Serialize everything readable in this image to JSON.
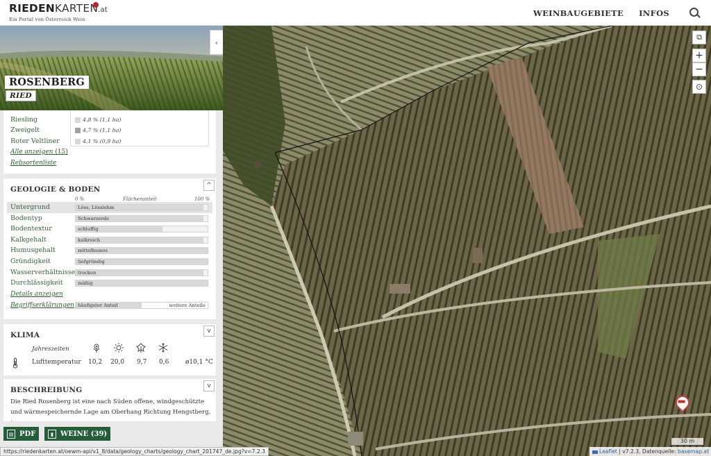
{
  "header": {
    "logo_bold": "RIEDEN",
    "logo_light": "KARTEN",
    "logo_tld": ".at",
    "logo_tagline": "Ein Portal von Österreich Wein",
    "nav": [
      "WEINBAUGEBIETE",
      "INFOS"
    ]
  },
  "ried": {
    "name": "ROSENBERG",
    "type": "RIED"
  },
  "sorten": {
    "items": [
      {
        "name": "Riesling",
        "value": "4,8 % (1,1 ha)",
        "share": 0.048
      },
      {
        "name": "Zweigelt",
        "value": "4,7 % (1,1 ha)",
        "share": 0.047
      },
      {
        "name": "Roter Veltliner",
        "value": "4,1 % (0,9 ha)",
        "share": 0.041
      }
    ],
    "show_all": "Alle anzeigen",
    "show_all_count": "(15)",
    "list_link": "Rebsortenliste"
  },
  "geologie": {
    "title": "GEOLOGIE & BODEN",
    "axis_start": "0 %",
    "axis_mid": "Flächenanteil",
    "axis_end": "100 %",
    "rows": [
      {
        "label": "Untergrund",
        "value": "Löss, Lösslehm",
        "fill": 0.97
      },
      {
        "label": "Bodentyp",
        "value": "Schwarzerde",
        "fill": 0.97
      },
      {
        "label": "Bodentextur",
        "value": "schluffig",
        "fill": 0.66
      },
      {
        "label": "Kalkgehalt",
        "value": "kalkreich",
        "fill": 0.97
      },
      {
        "label": "Humusgehalt",
        "value": "mittelhumos",
        "fill": 1.0
      },
      {
        "label": "Gründigkeit",
        "value": "tiefgründig",
        "fill": 1.0
      },
      {
        "label": "Wasserverhältnisse",
        "value": "trocken",
        "fill": 0.97
      },
      {
        "label": "Durchlässigkeit",
        "value": "mäßig",
        "fill": 1.0
      }
    ],
    "details_link": "Details anzeigen",
    "terms_link": "Begriffserklärungen",
    "legend_main": "häufigster Anteil",
    "legend_other": "weitere Anteile"
  },
  "klima": {
    "title": "KLIMA",
    "seasons_label": "Jahreszeiten",
    "row_label": "Lufttemperatur",
    "values": [
      "10,2",
      "20,0",
      "9,7",
      "0,6"
    ],
    "average": "ø10,1 °C",
    "icons": [
      "spring-flower-icon",
      "sun-icon",
      "autumn-leaf-icon",
      "snowflake-icon"
    ]
  },
  "beschreibung": {
    "title": "BESCHREIBUNG",
    "text": "Die Ried Rosenberg ist eine nach Süden offene, windgeschützte und wärmespeichernde Lage am Oberhang Richtung Hengstberg, im"
  },
  "actions": {
    "pdf": "PDF",
    "weine": "WEINE (39)"
  },
  "map": {
    "scale": "30 m",
    "attrib_leaflet": "Leaflet",
    "attrib_rest": " | v7.2.3, Datenquelle: ",
    "attrib_source": "basemap.at"
  },
  "status_url": "https://riedenkarten.at/oewm-api/v1_8/data/geology_charts/geology_chart_201747_de.jpg?v=7.2.3",
  "colors": {
    "accent": "#255c3a",
    "link": "#2f5c2f",
    "marker": "#b3262d"
  }
}
